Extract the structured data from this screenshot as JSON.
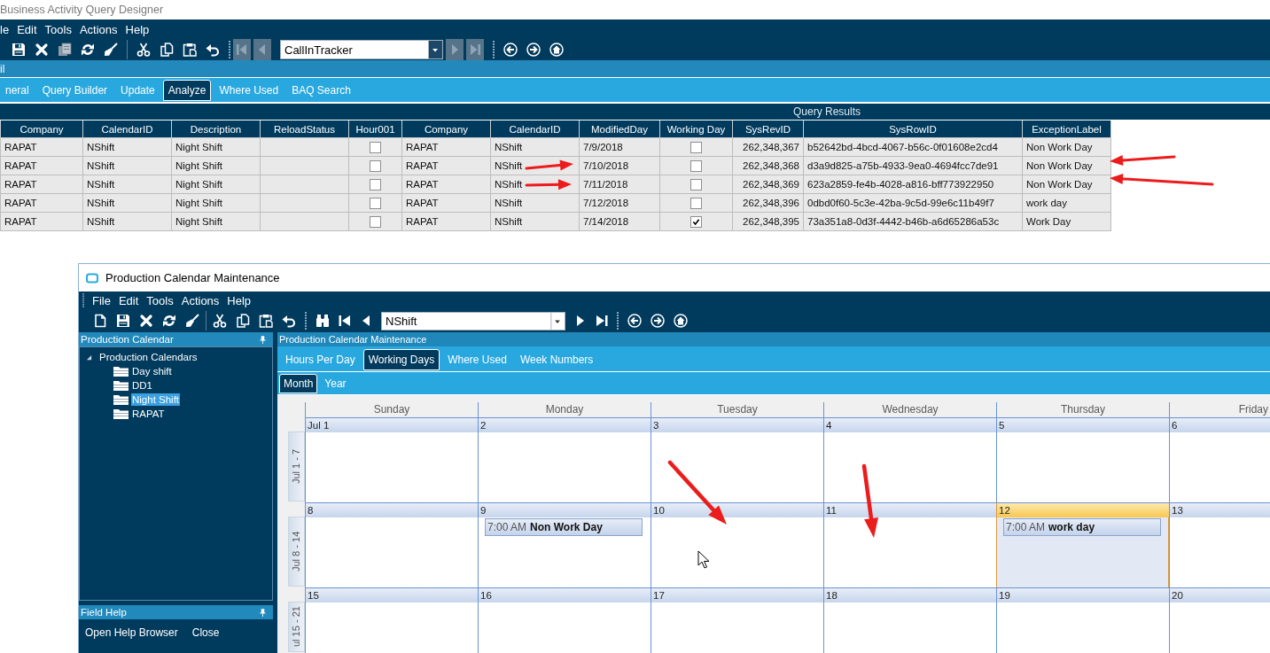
{
  "baq_window": {
    "title": "Business Activity Query Designer",
    "menu": [
      "le",
      "Edit",
      "Tools",
      "Actions",
      "Help"
    ],
    "toolbar": {
      "record": "CallInTracker",
      "navigation_disabled": true
    },
    "panel_title": "il",
    "tabs": [
      {
        "label": "neral",
        "selected": false
      },
      {
        "label": "Query Builder",
        "selected": false
      },
      {
        "label": "Update",
        "selected": false
      },
      {
        "label": "Analyze",
        "selected": true
      },
      {
        "label": "Where Used",
        "selected": false
      },
      {
        "label": "BAQ Search",
        "selected": false
      }
    ],
    "results": {
      "title": "Query Results",
      "columns": [
        {
          "label": "Company",
          "kind": "text"
        },
        {
          "label": "CalendarID",
          "kind": "text"
        },
        {
          "label": "Description",
          "kind": "text"
        },
        {
          "label": "ReloadStatus",
          "kind": "text"
        },
        {
          "label": "Hour001",
          "kind": "check"
        },
        {
          "label": "Company",
          "kind": "text"
        },
        {
          "label": "CalendarID",
          "kind": "text"
        },
        {
          "label": "ModifiedDay",
          "kind": "text"
        },
        {
          "label": "Working Day",
          "kind": "check"
        },
        {
          "label": "SysRevID",
          "kind": "number"
        },
        {
          "label": "SysRowID",
          "kind": "text"
        },
        {
          "label": "ExceptionLabel",
          "kind": "text"
        }
      ],
      "rows": [
        {
          "cells": [
            "RAPAT",
            "NShift",
            "Night Shift",
            null,
            false,
            "RAPAT",
            "NShift",
            "7/9/2018",
            false,
            "262,348,367",
            "b52642bd-4bcd-4067-b56c-0f01608e2cd4",
            "Non Work Day"
          ]
        },
        {
          "cells": [
            "RAPAT",
            "NShift",
            "Night Shift",
            null,
            false,
            "RAPAT",
            "NShift",
            "7/10/2018",
            false,
            "262,348,368",
            "d3a9d825-a75b-4933-9ea0-4694fcc7de91",
            "Non Work Day"
          ]
        },
        {
          "cells": [
            "RAPAT",
            "NShift",
            "Night Shift",
            null,
            false,
            "RAPAT",
            "NShift",
            "7/11/2018",
            false,
            "262,348,369",
            "623a2859-fe4b-4028-a816-bff773922950",
            "Non Work Day"
          ]
        },
        {
          "cells": [
            "RAPAT",
            "NShift",
            "Night Shift",
            null,
            false,
            "RAPAT",
            "NShift",
            "7/12/2018",
            false,
            "262,348,396",
            "0dbd0f60-5c3e-42ba-9c5d-99e6c11b49f7",
            "work day"
          ]
        },
        {
          "cells": [
            "RAPAT",
            "NShift",
            "Night Shift",
            null,
            false,
            "RAPAT",
            "NShift",
            "7/14/2018",
            true,
            "262,348,395",
            "73a351a8-0d3f-4442-b46b-a6d65286a53c",
            "Work Day"
          ]
        }
      ]
    }
  },
  "calendar_window": {
    "title": "Production Calendar Maintenance",
    "menu": [
      "File",
      "Edit",
      "Tools",
      "Actions",
      "Help"
    ],
    "toolbar": {
      "record": "NShift",
      "navigation_disabled": false
    },
    "tree_panel": {
      "title": "Production Calendar",
      "items": [
        {
          "label": "Production Calendars",
          "expanded": true,
          "selected": false,
          "children": [
            {
              "label": "Day shift",
              "selected": false
            },
            {
              "label": "DD1",
              "selected": false
            },
            {
              "label": "Night Shift",
              "selected": true
            },
            {
              "label": "RAPAT",
              "selected": false
            }
          ]
        }
      ]
    },
    "field_help": {
      "title": "Field Help",
      "actions": [
        "Open Help Browser",
        "Close"
      ]
    },
    "main_panel": {
      "title": "Production Calendar Maintenance",
      "tabs": [
        {
          "label": "Hours Per Day",
          "selected": false
        },
        {
          "label": "Working Days",
          "selected": true
        },
        {
          "label": "Where Used",
          "selected": false
        },
        {
          "label": "Week Numbers",
          "selected": false
        }
      ],
      "view_tabs": [
        {
          "label": "Month",
          "selected": true
        },
        {
          "label": "Year",
          "selected": false
        }
      ],
      "calendar": {
        "day_names": [
          "Sunday",
          "Monday",
          "Tuesday",
          "Wednesday",
          "Thursday",
          "Friday"
        ],
        "weeks": [
          {
            "label": "Jul 1 - 7",
            "days": [
              {
                "date": "Jul 1",
                "today": false
              },
              {
                "date": "2",
                "today": false
              },
              {
                "date": "3",
                "today": false
              },
              {
                "date": "4",
                "today": false
              },
              {
                "date": "5",
                "today": false
              },
              {
                "date": "6",
                "today": false
              }
            ]
          },
          {
            "label": "Jul 8 - 14",
            "days": [
              {
                "date": "8",
                "today": false
              },
              {
                "date": "9",
                "today": false,
                "appointments": [
                  {
                    "time": "7:00 AM",
                    "subject": "Non Work Day"
                  }
                ]
              },
              {
                "date": "10",
                "today": false
              },
              {
                "date": "11",
                "today": false
              },
              {
                "date": "12",
                "today": true,
                "appointments": [
                  {
                    "time": "7:00 AM",
                    "subject": "work day"
                  }
                ]
              },
              {
                "date": "13",
                "today": false
              }
            ]
          },
          {
            "label": "ul 15 - 21",
            "days": [
              {
                "date": "15",
                "today": false
              },
              {
                "date": "16",
                "today": false
              },
              {
                "date": "17",
                "today": false
              },
              {
                "date": "18",
                "today": false
              },
              {
                "date": "19",
                "today": false
              },
              {
                "date": "20",
                "today": false
              }
            ]
          }
        ]
      }
    }
  }
}
